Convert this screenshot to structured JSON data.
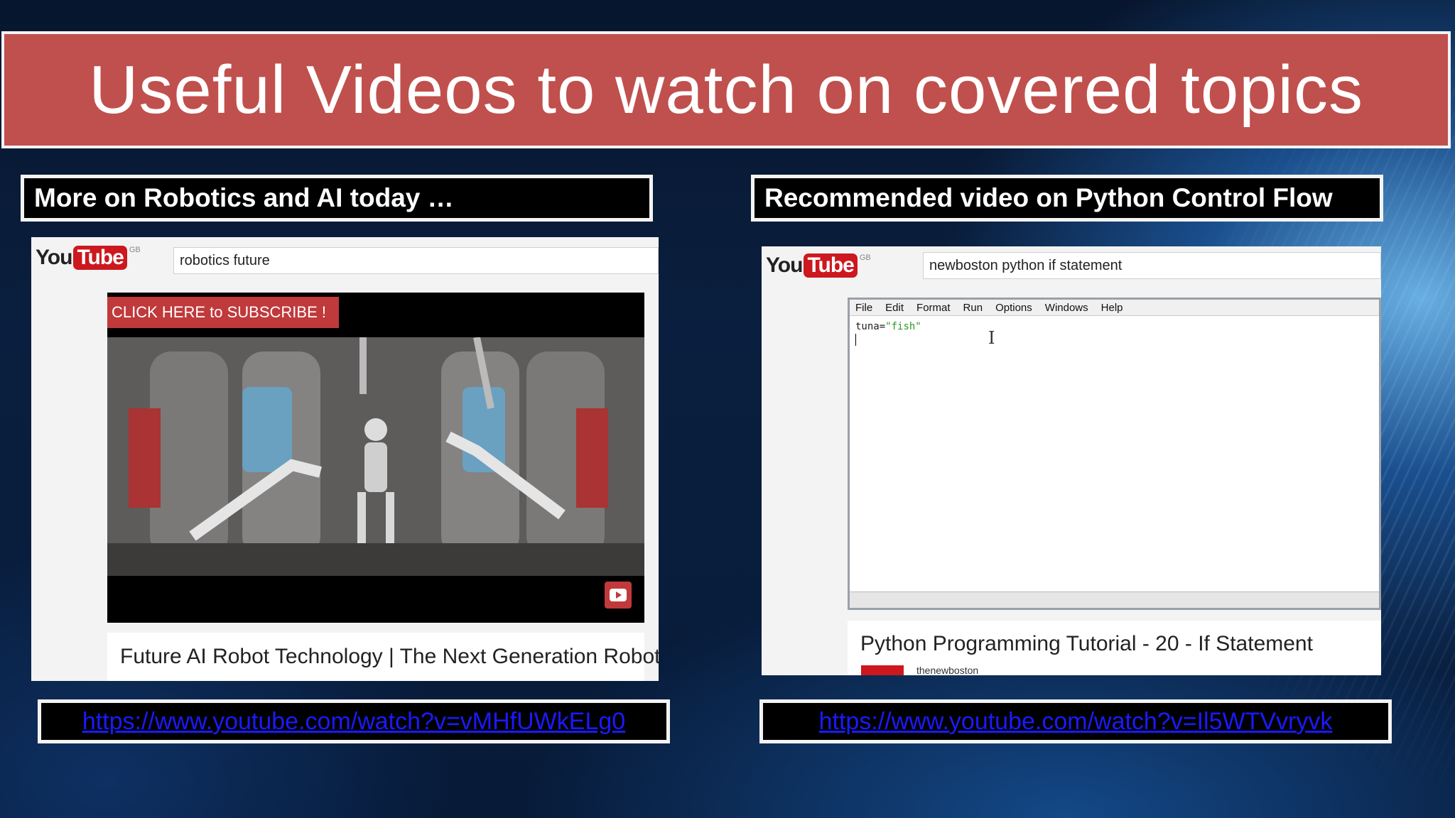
{
  "title": "Useful Videos to watch on covered topics",
  "left": {
    "heading": "More on Robotics and AI today …",
    "youtube_logo": {
      "you": "You",
      "tube": "Tube",
      "region": "GB"
    },
    "search_query": "robotics future",
    "subscribe_banner": "CLICK HERE to  SUBSCRIBE !",
    "video_title": "Future AI Robot Technology | The Next Generation Robot",
    "link": "https://www.youtube.com/watch?v=vMHfUWkELg0"
  },
  "right": {
    "heading": "Recommended video on Python Control Flow",
    "youtube_logo": {
      "you": "You",
      "tube": "Tube",
      "region": "GB"
    },
    "search_query": "newboston python if statement",
    "menu": [
      "File",
      "Edit",
      "Format",
      "Run",
      "Options",
      "Windows",
      "Help"
    ],
    "code_var": "tuna=",
    "code_string": "\"fish\"",
    "video_title": "Python Programming Tutorial - 20 - If Statement",
    "channel": "thenewboston",
    "link": "https://www.youtube.com/watch?v=Il5WTVvryvk"
  },
  "colors": {
    "banner": "#c0504d",
    "youtube_red": "#cc181e",
    "link": "#1a1aff"
  }
}
